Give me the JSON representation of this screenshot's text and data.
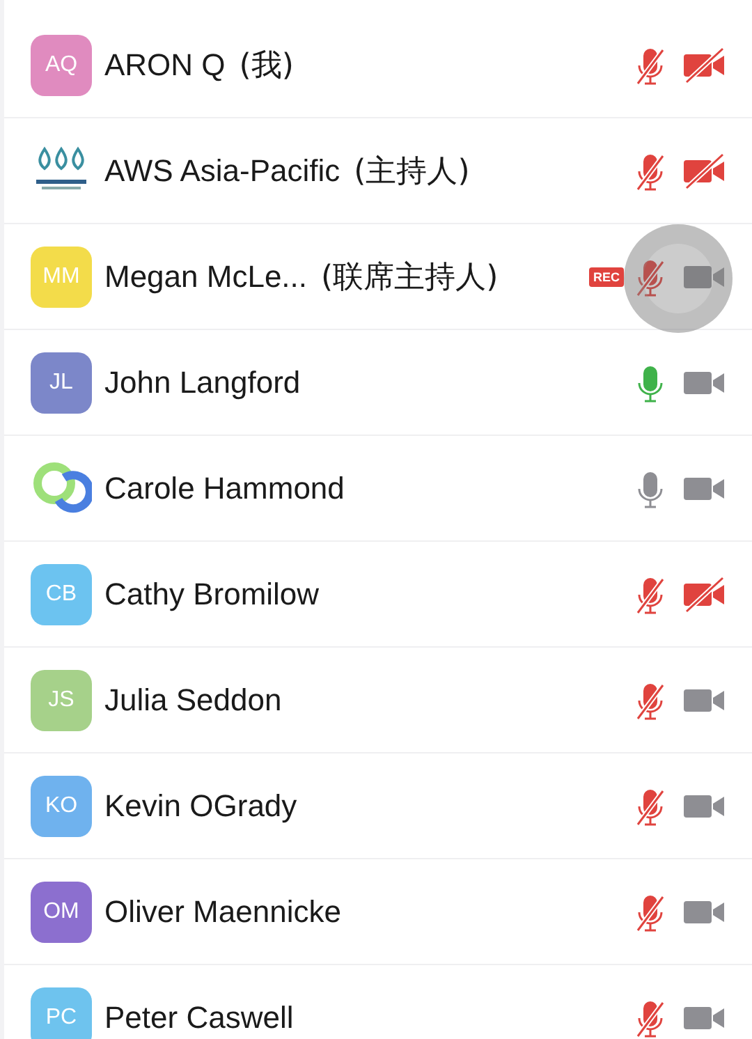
{
  "participants": [
    {
      "avatar": {
        "kind": "initials",
        "text": "AQ",
        "color": "#e08bbf"
      },
      "name": "ARON Q",
      "role": "(我)",
      "recording": false,
      "mic_muted": true,
      "video_on": false,
      "touch_indicator": false
    },
    {
      "avatar": {
        "kind": "logo"
      },
      "name": "AWS Asia-Pacific",
      "role": "(主持人)",
      "recording": false,
      "mic_muted": true,
      "video_on": false,
      "touch_indicator": false
    },
    {
      "avatar": {
        "kind": "initials",
        "text": "MM",
        "color": "#f3dc4a"
      },
      "name": "Megan McLe...",
      "role": "(联席主持人)",
      "recording": true,
      "rec_label": "REC",
      "mic_muted": true,
      "video_on": true,
      "touch_indicator": true
    },
    {
      "avatar": {
        "kind": "initials",
        "text": "JL",
        "color": "#7c87c9"
      },
      "name": "John Langford",
      "recording": false,
      "mic_muted": false,
      "speaking": true,
      "video_on": true,
      "touch_indicator": false
    },
    {
      "avatar": {
        "kind": "rings"
      },
      "name": "Carole Hammond",
      "recording": false,
      "mic_muted": false,
      "speaking": false,
      "video_on": true,
      "touch_indicator": false
    },
    {
      "avatar": {
        "kind": "initials",
        "text": "CB",
        "color": "#6cc3f0"
      },
      "name": "Cathy Bromilow",
      "recording": false,
      "mic_muted": true,
      "video_on": false,
      "touch_indicator": false
    },
    {
      "avatar": {
        "kind": "initials",
        "text": "JS",
        "color": "#a6d18a"
      },
      "name": "Julia Seddon",
      "recording": false,
      "mic_muted": true,
      "video_on": true,
      "touch_indicator": false
    },
    {
      "avatar": {
        "kind": "initials",
        "text": "KO",
        "color": "#6fb2ee"
      },
      "name": "Kevin OGrady",
      "recording": false,
      "mic_muted": true,
      "video_on": true,
      "touch_indicator": false
    },
    {
      "avatar": {
        "kind": "initials",
        "text": "OM",
        "color": "#8c6fcf"
      },
      "name": "Oliver Maennicke",
      "recording": false,
      "mic_muted": true,
      "video_on": true,
      "touch_indicator": false
    },
    {
      "avatar": {
        "kind": "initials",
        "text": "PC",
        "color": "#6ec3ee"
      },
      "name": "Peter Caswell",
      "recording": false,
      "mic_muted": true,
      "video_on": true,
      "touch_indicator": false
    }
  ]
}
